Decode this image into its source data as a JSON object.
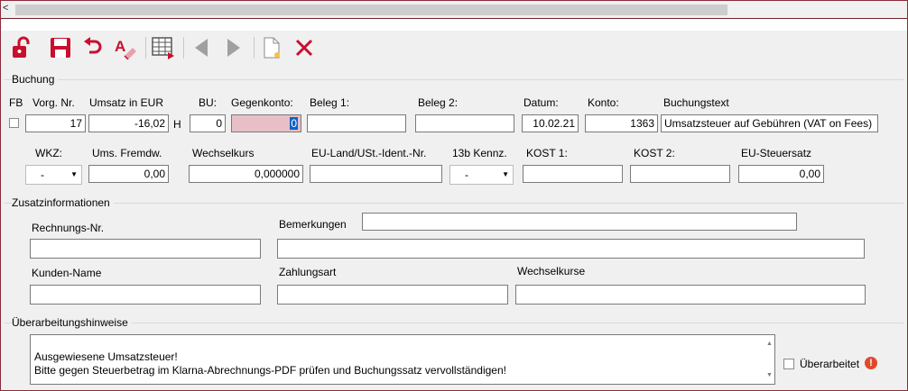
{
  "scroll": {
    "left_arrow": "<"
  },
  "toolbar": {
    "icons": [
      "unlock-icon",
      "save-icon",
      "undo-icon",
      "spellcheck-icon",
      "table-export-icon",
      "prev-icon",
      "next-icon",
      "new-document-icon",
      "delete-icon"
    ],
    "colors": {
      "red": "#c8102e",
      "disabled": "#a0a0a0"
    }
  },
  "buchung": {
    "title": "Buchung",
    "labels": {
      "fb": "FB",
      "vorg_nr": "Vorg. Nr.",
      "umsatz": "Umsatz in EUR",
      "bu": "BU:",
      "gegenkonto": "Gegenkonto:",
      "beleg1": "Beleg 1:",
      "beleg2": "Beleg 2:",
      "datum": "Datum:",
      "konto": "Konto:",
      "buchungstext": "Buchungstext",
      "wkz": "WKZ:",
      "ums_fremdw": "Ums. Fremdw.",
      "wechselkurs": "Wechselkurs",
      "eu_land": "EU-Land/USt.-Ident.-Nr.",
      "kennz_13b": "13b Kennz.",
      "kost1": "KOST 1:",
      "kost2": "KOST 2:",
      "eu_steuersatz": "EU-Steuersatz"
    },
    "values": {
      "vorg_nr": "17",
      "umsatz": "-16,02",
      "soll_haben": "H",
      "bu": "0",
      "gegenkonto": "0",
      "beleg1": "",
      "beleg2": "",
      "datum": "10.02.21",
      "konto": "1363",
      "buchungstext": "Umsatzsteuer auf Gebühren  (VAT on Fees)",
      "wkz": "-",
      "ums_fremdw": "0,00",
      "wechselkurs": "0,000000",
      "eu_land": "",
      "kennz_13b": "-",
      "kost1": "",
      "kost2": "",
      "eu_steuersatz": "0,00"
    }
  },
  "zusatz": {
    "title": "Zusatzinformationen",
    "labels": {
      "rechnungs_nr": "Rechnungs-Nr.",
      "bemerkungen": "Bemerkungen",
      "kunden_name": "Kunden-Name",
      "zahlungsart": "Zahlungsart",
      "wechselkurse": "Wechselkurse"
    },
    "values": {
      "rechnungs_nr": "",
      "bemerkungen_top": "",
      "bemerkungen": "",
      "kunden_name": "",
      "zahlungsart": "",
      "wechselkurse": ""
    }
  },
  "hinweise": {
    "title": "Überarbeitungshinweise",
    "text": "Ausgewiesene Umsatzsteuer!\nBitte gegen Steuerbetrag im Klarna-Abrechnungs-PDF prüfen und Buchungssatz vervollständigen!",
    "ueberarbeitet_label": "Überarbeitet",
    "warning_icon_text": "!",
    "warning_color": "#e0492b"
  }
}
